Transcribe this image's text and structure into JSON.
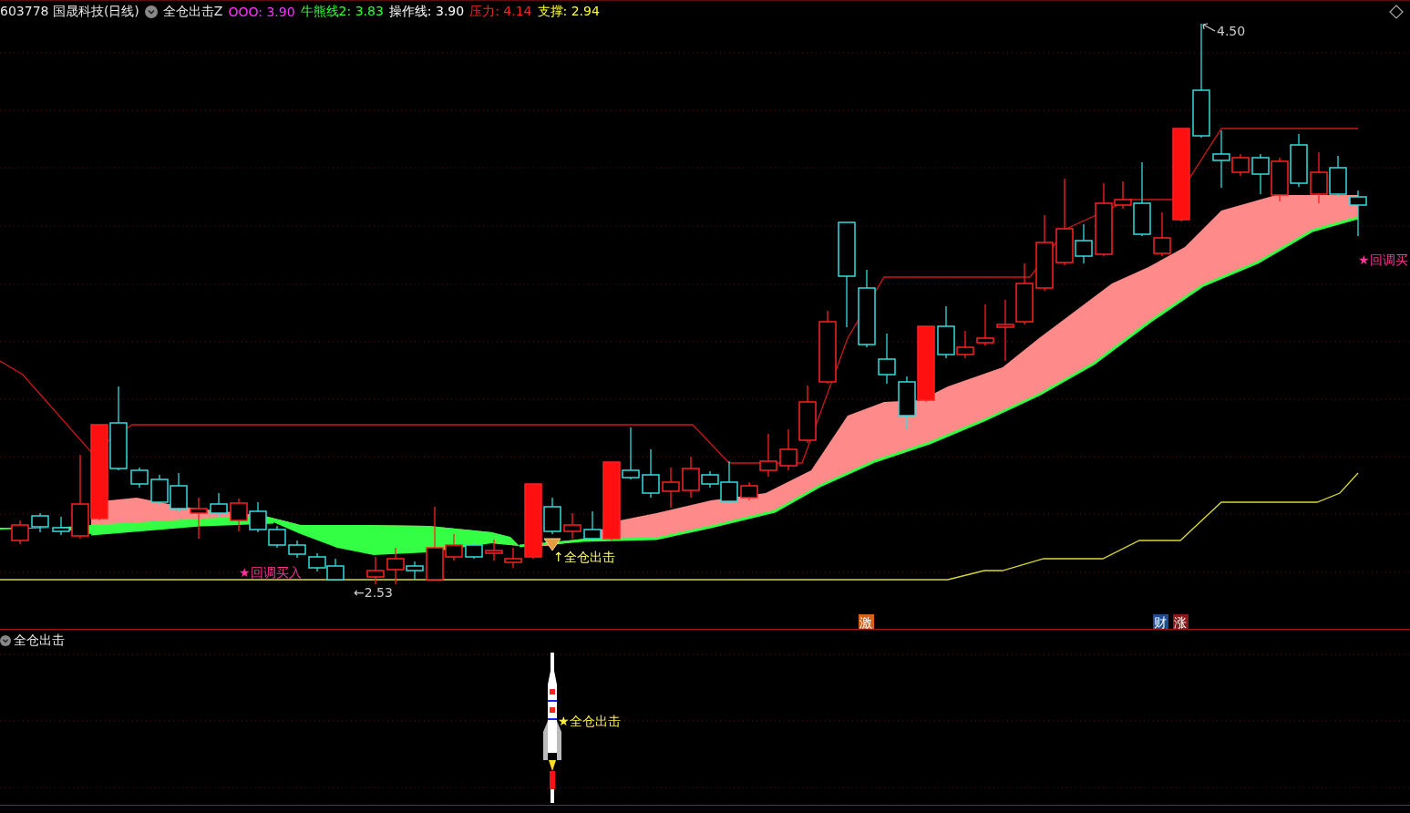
{
  "header": {
    "symbol": "603778",
    "name": "国晟科技(日线)",
    "indicator": "全仓出击Z",
    "readouts": [
      {
        "text": "OOO: 3.90",
        "color": "#ff33ff"
      },
      {
        "text": "牛熊线2: 3.83",
        "color": "#33ff33"
      },
      {
        "text": "操作线: 3.90",
        "color": "#ffffff"
      },
      {
        "text": "压力: 4.14",
        "color": "#ff2222"
      },
      {
        "text": "支撑: 2.94",
        "color": "#ffff33"
      }
    ]
  },
  "main_chart": {
    "high_label": "4.50",
    "low_label": "←2.53",
    "signals": [
      {
        "text": "★回调买入",
        "color": "#ff3399"
      },
      {
        "text": "↑全仓出击",
        "color": "#ffff66"
      },
      {
        "text": "★回调买",
        "color": "#ff3399"
      }
    ],
    "badges": [
      {
        "text": "激",
        "color": "#d4621a"
      },
      {
        "text": "财",
        "color": "#1e4f8a"
      },
      {
        "text": "涨",
        "color": "#8a1a1a"
      }
    ]
  },
  "lower_panel": {
    "title": "全仓出击",
    "signal": "★全仓出击"
  }
}
